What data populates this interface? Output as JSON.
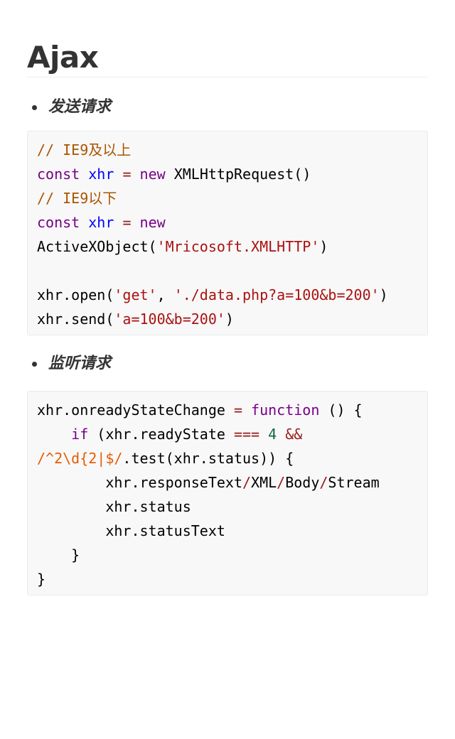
{
  "heading": "Ajax",
  "sections": [
    {
      "label": "发送请求",
      "lines": [
        [
          {
            "t": "// IE9及以上",
            "c": "comment"
          }
        ],
        [
          {
            "t": "const",
            "c": "kw"
          },
          {
            "t": " ",
            "c": "plain"
          },
          {
            "t": "xhr",
            "c": "def"
          },
          {
            "t": " ",
            "c": "plain"
          },
          {
            "t": "=",
            "c": "op"
          },
          {
            "t": " ",
            "c": "plain"
          },
          {
            "t": "new",
            "c": "kw"
          },
          {
            "t": " XMLHttpRequest()",
            "c": "plain"
          }
        ],
        [
          {
            "t": "// IE9以下",
            "c": "comment"
          }
        ],
        [
          {
            "t": "const",
            "c": "kw"
          },
          {
            "t": " ",
            "c": "plain"
          },
          {
            "t": "xhr",
            "c": "def"
          },
          {
            "t": " ",
            "c": "plain"
          },
          {
            "t": "=",
            "c": "op"
          },
          {
            "t": " ",
            "c": "plain"
          },
          {
            "t": "new",
            "c": "kw"
          }
        ],
        [
          {
            "t": "ActiveXObject(",
            "c": "plain"
          },
          {
            "t": "'Mricosoft.XMLHTTP'",
            "c": "str"
          },
          {
            "t": ")",
            "c": "plain"
          }
        ],
        [
          {
            "t": " ",
            "c": "plain"
          }
        ],
        [
          {
            "t": "xhr.open(",
            "c": "plain"
          },
          {
            "t": "'get'",
            "c": "str"
          },
          {
            "t": ", ",
            "c": "plain"
          },
          {
            "t": "'./data.php?a=100&b=200'",
            "c": "str"
          },
          {
            "t": ")",
            "c": "plain"
          }
        ],
        [
          {
            "t": "xhr.send(",
            "c": "plain"
          },
          {
            "t": "'a=100&b=200'",
            "c": "str"
          },
          {
            "t": ")",
            "c": "plain"
          }
        ]
      ]
    },
    {
      "label": "监听请求",
      "lines": [
        [
          {
            "t": "xhr.onreadyStateChange",
            "c": "plain"
          },
          {
            "t": " ",
            "c": "plain"
          },
          {
            "t": "=",
            "c": "op"
          },
          {
            "t": " ",
            "c": "plain"
          },
          {
            "t": "function",
            "c": "kw"
          },
          {
            "t": " () {",
            "c": "plain"
          }
        ],
        [
          {
            "t": "    ",
            "c": "plain"
          },
          {
            "t": "if",
            "c": "kw"
          },
          {
            "t": " (xhr.readyState ",
            "c": "plain"
          },
          {
            "t": "===",
            "c": "op"
          },
          {
            "t": " ",
            "c": "plain"
          },
          {
            "t": "4",
            "c": "num"
          },
          {
            "t": " ",
            "c": "plain"
          },
          {
            "t": "&&",
            "c": "op"
          }
        ],
        [
          {
            "t": "/^2\\d{2|$/",
            "c": "regex"
          },
          {
            "t": ".test(xhr.status)) {",
            "c": "plain"
          }
        ],
        [
          {
            "t": "        xhr.responseText",
            "c": "plain"
          },
          {
            "t": "/",
            "c": "op"
          },
          {
            "t": "XML",
            "c": "plain"
          },
          {
            "t": "/",
            "c": "op"
          },
          {
            "t": "Body",
            "c": "plain"
          },
          {
            "t": "/",
            "c": "op"
          },
          {
            "t": "Stream",
            "c": "plain"
          }
        ],
        [
          {
            "t": "        xhr.status",
            "c": "plain"
          }
        ],
        [
          {
            "t": "        xhr.statusText",
            "c": "plain"
          }
        ],
        [
          {
            "t": "    }",
            "c": "plain"
          }
        ],
        [
          {
            "t": "}",
            "c": "plain"
          }
        ]
      ]
    }
  ]
}
